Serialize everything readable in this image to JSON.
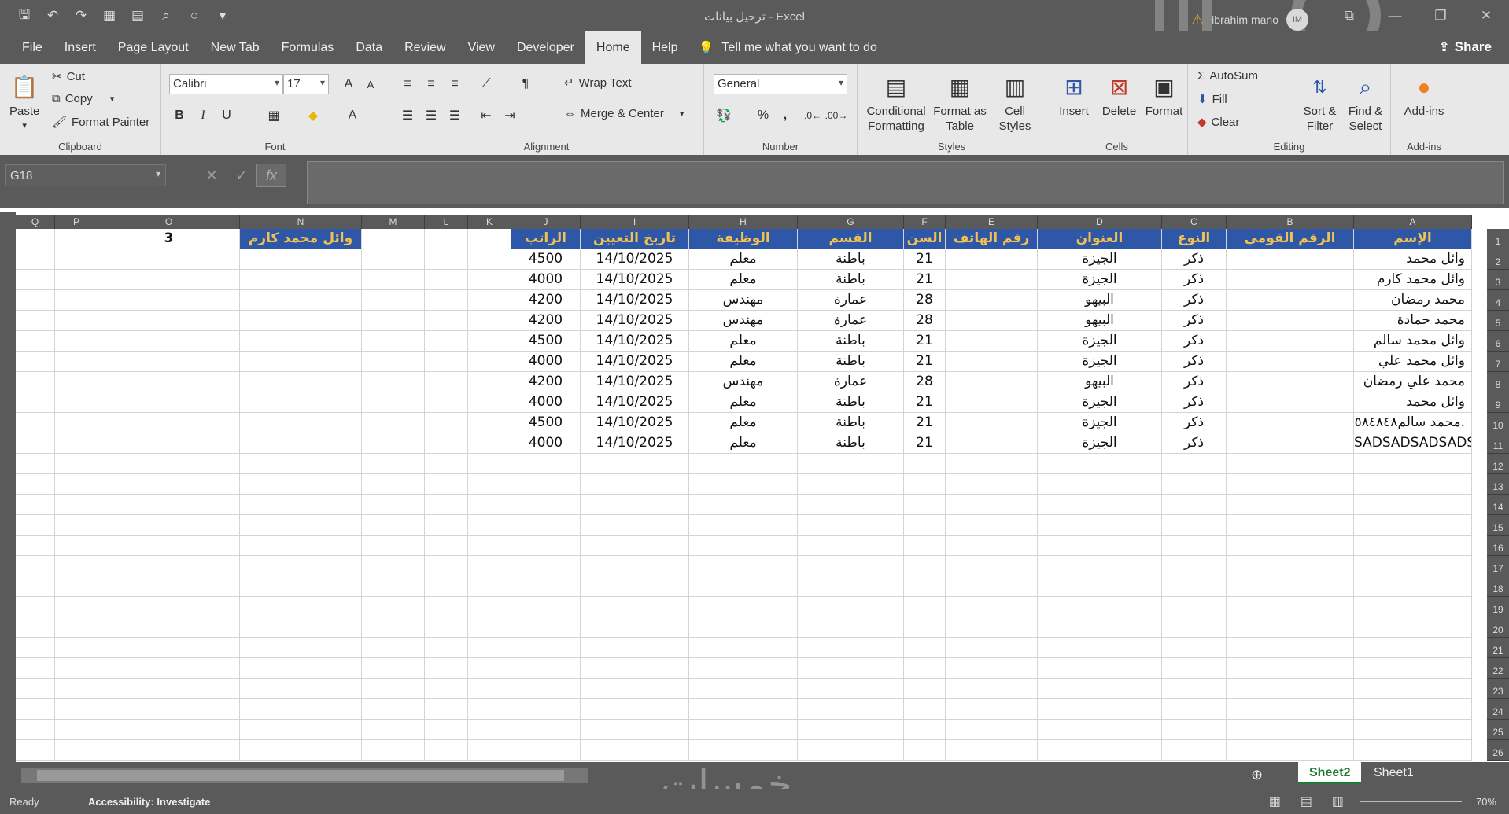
{
  "titlebar": {
    "title": "ترحيل بيانات  -  Excel",
    "user_name": "ibrahim mano",
    "user_initials": "IM"
  },
  "menu": {
    "tabs": [
      "File",
      "Insert",
      "Page Layout",
      "New Tab",
      "Formulas",
      "Data",
      "Review",
      "View",
      "Developer",
      "Home",
      "Help"
    ],
    "active_tab": "Home",
    "tell_me": "Tell me what you want to do",
    "share": "Share"
  },
  "ribbon": {
    "clipboard": {
      "paste": "Paste",
      "cut": "Cut",
      "copy": "Copy",
      "format_painter": "Format Painter",
      "label": "Clipboard"
    },
    "font": {
      "name": "Calibri",
      "size": "17",
      "label": "Font",
      "bold": "B",
      "italic": "I",
      "underline": "U",
      "grow": "A",
      "shrink": "A"
    },
    "alignment": {
      "wrap_text": "Wrap Text",
      "merge_center": "Merge & Center",
      "label": "Alignment"
    },
    "number": {
      "format": "General",
      "label": "Number",
      "percent": "%",
      "comma": ","
    },
    "styles": {
      "conditional": "Conditional Formatting",
      "format_table": "Format as Table",
      "cell_styles": "Cell Styles",
      "label": "Styles"
    },
    "cells": {
      "insert": "Insert",
      "delete": "Delete",
      "format": "Format",
      "label": "Cells"
    },
    "editing": {
      "autosum": "AutoSum",
      "fill": "Fill",
      "clear": "Clear",
      "sort_filter": "Sort & Filter",
      "find_select": "Find & Select",
      "label": "Editing"
    },
    "addins": {
      "addins": "Add-ins",
      "label": "Add-ins"
    }
  },
  "formula_bar": {
    "name_box": "G18",
    "fx": "fx",
    "cancel": "✕",
    "enter": "✓"
  },
  "columns": [
    "Q",
    "P",
    "O",
    "N",
    "M",
    "L",
    "K",
    "J",
    "I",
    "H",
    "G",
    "F",
    "E",
    "D",
    "C",
    "B",
    "A"
  ],
  "row_numbers": [
    "1",
    "2",
    "3",
    "4",
    "5",
    "6",
    "7",
    "8",
    "9",
    "10",
    "11",
    "12",
    "13",
    "14",
    "15",
    "16",
    "17",
    "18",
    "19",
    "20",
    "21",
    "22",
    "23",
    "24",
    "25",
    "26"
  ],
  "side_cells": {
    "o1": "3",
    "n1": "وائل محمد كارم"
  },
  "table": {
    "headers": {
      "J": "الراتب",
      "I": "تاريخ التعيين",
      "H": "الوظيفة",
      "G": "القسم",
      "F": "السن",
      "E": "رقم الهاتف",
      "D": "العنوان",
      "C": "النوع",
      "B": "الرقم القومي",
      "A": "الإسم"
    },
    "rows": [
      {
        "J": "4500",
        "I": "14/10/2025",
        "H": "معلم",
        "G": "باطنة",
        "F": "21",
        "E": "",
        "D": "الجيزة",
        "C": "ذكر",
        "B": "",
        "A": "وائل محمد"
      },
      {
        "J": "4000",
        "I": "14/10/2025",
        "H": "معلم",
        "G": "باطنة",
        "F": "21",
        "E": "",
        "D": "الجيزة",
        "C": "ذكر",
        "B": "",
        "A": "وائل محمد كارم"
      },
      {
        "J": "4200",
        "I": "14/10/2025",
        "H": "مهندس",
        "G": "عمارة",
        "F": "28",
        "E": "",
        "D": "البيهو",
        "C": "ذكر",
        "B": "",
        "A": "محمد  رمضان"
      },
      {
        "J": "4200",
        "I": "14/10/2025",
        "H": "مهندس",
        "G": "عمارة",
        "F": "28",
        "E": "",
        "D": "البيهو",
        "C": "ذكر",
        "B": "",
        "A": "محمد حمادة"
      },
      {
        "J": "4500",
        "I": "14/10/2025",
        "H": "معلم",
        "G": "باطنة",
        "F": "21",
        "E": "",
        "D": "الجيزة",
        "C": "ذكر",
        "B": "",
        "A": "وائل محمد سالم"
      },
      {
        "J": "4000",
        "I": "14/10/2025",
        "H": "معلم",
        "G": "باطنة",
        "F": "21",
        "E": "",
        "D": "الجيزة",
        "C": "ذكر",
        "B": "",
        "A": "وائل محمد علي"
      },
      {
        "J": "4200",
        "I": "14/10/2025",
        "H": "مهندس",
        "G": "عمارة",
        "F": "28",
        "E": "",
        "D": "البيهو",
        "C": "ذكر",
        "B": "",
        "A": "محمد علي رمضان"
      },
      {
        "J": "4000",
        "I": "14/10/2025",
        "H": "معلم",
        "G": "باطنة",
        "F": "21",
        "E": "",
        "D": "الجيزة",
        "C": "ذكر",
        "B": "",
        "A": "وائل محمد"
      },
      {
        "J": "4500",
        "I": "14/10/2025",
        "H": "معلم",
        "G": "باطنة",
        "F": "21",
        "E": "",
        "D": "الجيزة",
        "C": "ذكر",
        "B": "",
        "A": "محمد سالم٥٨٤٨٤٨."
      },
      {
        "J": "4000",
        "I": "14/10/2025",
        "H": "معلم",
        "G": "باطنة",
        "F": "21",
        "E": "",
        "D": "الجيزة",
        "C": "ذكر",
        "B": "",
        "A": "SADSADSADSADSA"
      }
    ]
  },
  "sheets": [
    "Sheet2",
    "Sheet1"
  ],
  "active_sheet": "Sheet2",
  "status": {
    "ready": "Ready",
    "accessibility": "Accessibility: Investigate",
    "zoom": "70%"
  },
  "watermark": "خمسات"
}
